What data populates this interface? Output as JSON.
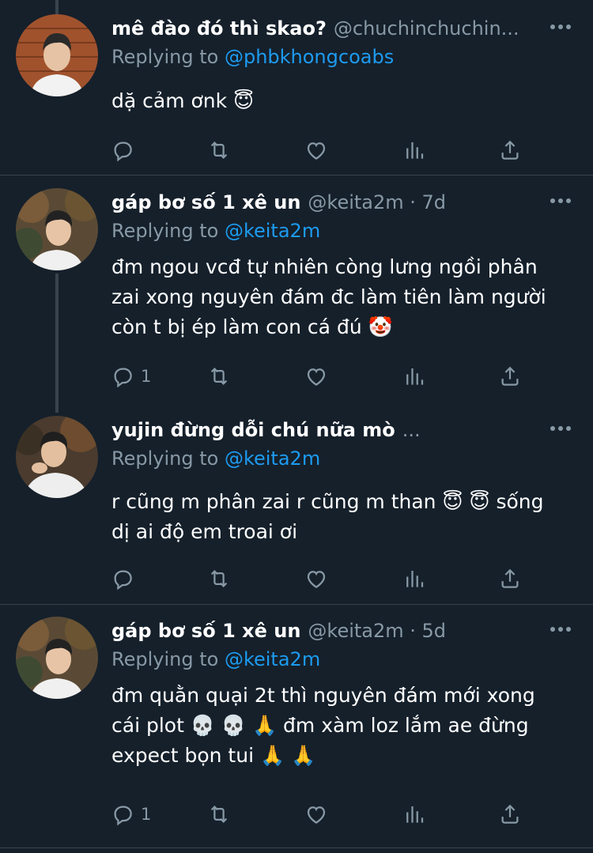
{
  "tweets": [
    {
      "name": "mê đào đó thì skao?",
      "handle": "@chuchinchuchin...",
      "reply_prefix": "Replying to",
      "reply_to": "@phbkhongcoabs",
      "lines": [
        "dặ cảm ơnk 😇"
      ],
      "reply_count": ""
    },
    {
      "name": "gáp bơ số 1 xê un",
      "handle": "@keita2m · 7d",
      "reply_prefix": "Replying to",
      "reply_to": "@keita2m",
      "lines": [
        "đm ngou vcđ tự nhiên còng lưng ngồi phân",
        "zai xong nguyên đám đc làm tiên làm người",
        "còn t bị ép làm con cá đú 🤡"
      ],
      "reply_count": "1"
    },
    {
      "name": "yujin đừng dỗi chú nữa mò",
      "handle": "...",
      "reply_prefix": "Replying to",
      "reply_to": "@keita2m",
      "lines": [
        "r cũng m phân zai r cũng m than 😇 😇  sống",
        "dị ai độ em troai ơi"
      ],
      "reply_count": ""
    },
    {
      "name": "gáp bơ số 1 xê un",
      "handle": "@keita2m · 5d",
      "reply_prefix": "Replying to",
      "reply_to": "@keita2m",
      "lines": [
        "đm quằn quại 2t thì nguyên đám mới xong",
        "cái plot 💀 💀 🙏  đm xàm loz lắm ae đừng",
        "expect bọn tui 🙏 🙏"
      ],
      "reply_count": "1"
    }
  ],
  "colors": {
    "background": "#15202b",
    "text": "#ffffff",
    "muted": "#8899a6",
    "link": "#1d9bf0",
    "divider": "#38444d"
  },
  "icons": [
    "reply-icon",
    "retweet-icon",
    "like-icon",
    "views-icon",
    "share-icon",
    "more-icon"
  ]
}
